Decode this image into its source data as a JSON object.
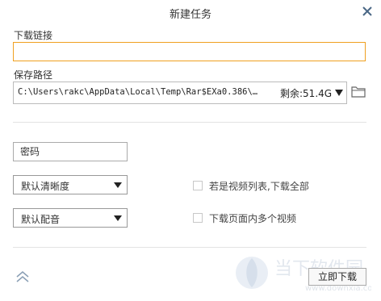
{
  "dialog": {
    "title": "新建任务",
    "close_icon": "close-icon"
  },
  "link": {
    "label": "下载链接",
    "value": "",
    "placeholder": ""
  },
  "save_path": {
    "label": "保存路径",
    "path": "C:\\Users\\rakc\\AppData\\Local\\Temp\\Rar$EXa0.386\\…",
    "free_space": "剩余:51.4G",
    "dropdown_icon": "triangle-down-icon",
    "folder_icon": "folder-icon"
  },
  "password": {
    "placeholder": "密码"
  },
  "quality_select": {
    "selected": "默认清晰度"
  },
  "audio_select": {
    "selected": "默认配音"
  },
  "checkboxes": [
    {
      "label": "若是视频列表,下载全部",
      "checked": false
    },
    {
      "label": "下载页面内多个视频",
      "checked": false
    }
  ],
  "footer": {
    "collapse_icon": "double-chevron-up-icon",
    "download_button": "立即下载"
  },
  "watermark": {
    "text": "当下软件园",
    "url": "www.downxia.com"
  },
  "colors": {
    "accent_border": "#f0a020",
    "divider": "#e3e3e3"
  }
}
